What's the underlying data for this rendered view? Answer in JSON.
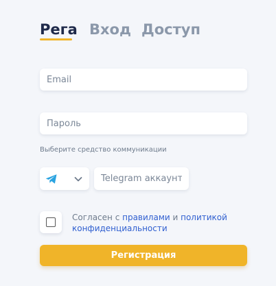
{
  "tabs": {
    "register": "Рега",
    "login": "Вход",
    "access": "Доступ"
  },
  "form": {
    "email_placeholder": "Email",
    "password_placeholder": "Пароль",
    "communication_hint": "Выберите средство коммуникации",
    "telegram_placeholder": "Telegram аккаунт*",
    "selected_channel_icon": "telegram-icon",
    "agree_prefix": "Согласен с ",
    "agree_rules_link": "правилами",
    "agree_and": " и ",
    "agree_privacy_link": "политикой конфиденциальности",
    "agree_checked": false,
    "submit_label": "Регистрация"
  },
  "colors": {
    "accent": "#f0b429",
    "active_tab": "#1f2a4a",
    "inactive_tab": "#8b98aa",
    "link": "#2f5fd0",
    "telegram": "#2aa3e0",
    "background": "#f4f6fa"
  }
}
